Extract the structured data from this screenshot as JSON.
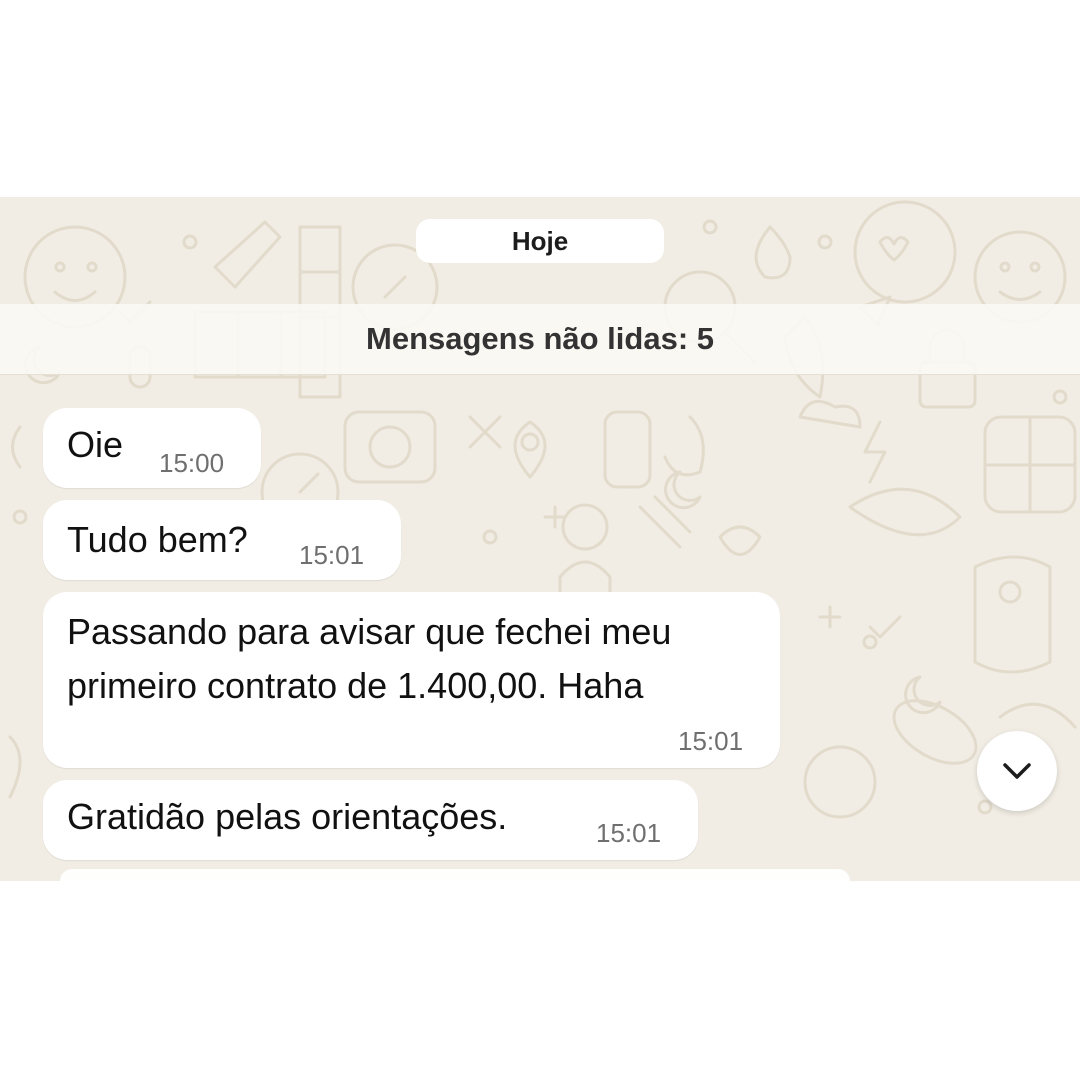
{
  "date_separator": "Hoje",
  "unread_banner": "Mensagens não lidas: 5",
  "messages": [
    {
      "text_lines": [
        "Oie"
      ],
      "time": "15:00"
    },
    {
      "text_lines": [
        "Tudo bem?"
      ],
      "time": "15:01"
    },
    {
      "text_lines": [
        "Passando para avisar que fechei meu",
        "primeiro contrato de 1.400,00. Haha"
      ],
      "time": "15:01"
    },
    {
      "text_lines": [
        "Gratidão pelas orientações."
      ],
      "time": "15:01"
    }
  ],
  "scroll_button": {
    "icon": "chevron-down-icon"
  },
  "colors": {
    "wallpaper": "#f1ede4",
    "doodle": "#e3dccd",
    "bubble": "#ffffff",
    "timestamp": "#6f6f6f"
  }
}
